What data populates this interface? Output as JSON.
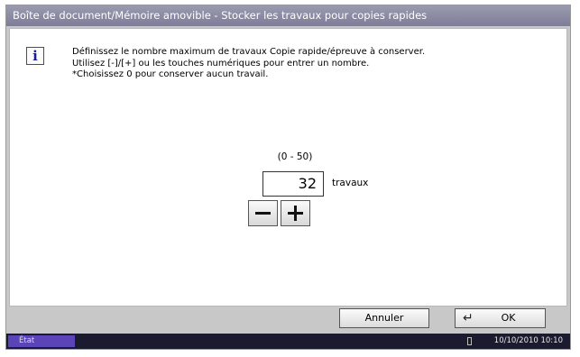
{
  "titlebar": {
    "title": "Boîte de document/Mémoire amovible - Stocker les travaux pour copies rapides"
  },
  "info": {
    "icon": "info-icon",
    "lines": [
      "Définissez le nombre maximum de travaux Copie rapide/épreuve à conserver.",
      "Utilisez [-]/[+] ou les touches numériques pour entrer un nombre.",
      "*Choisissez 0 pour conserver aucun travail."
    ]
  },
  "input": {
    "range_label": "(0 - 50)",
    "value": "32",
    "unit": "travaux",
    "decrement_icon": "minus-icon",
    "increment_icon": "plus-icon"
  },
  "footer": {
    "cancel_label": "Annuler",
    "ok_label": "OK",
    "ok_icon": "enter-icon"
  },
  "status": {
    "state_label": "État",
    "datetime": "10/10/2010 10:10",
    "media_icon": "memory-card-icon"
  }
}
